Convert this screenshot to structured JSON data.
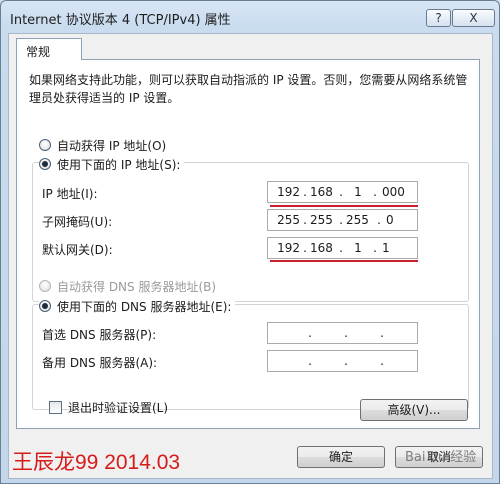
{
  "window": {
    "title": "Internet 协议版本 4 (TCP/IPv4) 属性",
    "help_label": "?",
    "close_label": "X"
  },
  "tab": {
    "general_label": "常规"
  },
  "description": "如果网络支持此功能，则可以获取自动指派的 IP 设置。否则，您需要从网络系统管理员处获得适当的 IP 设置。",
  "ip_section": {
    "auto_label": "自动获得 IP 地址(O)",
    "manual_label": "使用下面的 IP 地址(S):",
    "fields": [
      {
        "label": "IP 地址(I):",
        "octets": [
          "192",
          "168",
          "1",
          "000"
        ],
        "sep": "."
      },
      {
        "label": "子网掩码(U):",
        "octets": [
          "255",
          "255",
          "255",
          "0"
        ],
        "sep": "."
      },
      {
        "label": "默认网关(D):",
        "octets": [
          "192",
          "168",
          "1",
          "1"
        ],
        "sep": "."
      }
    ]
  },
  "dns_section": {
    "auto_label": "自动获得 DNS 服务器地址(B)",
    "manual_label": "使用下面的 DNS 服务器地址(E):",
    "fields": [
      {
        "label": "首选 DNS 服务器(P):",
        "octets": [
          "",
          "",
          "",
          ""
        ],
        "sep": "."
      },
      {
        "label": "备用 DNS 服务器(A):",
        "octets": [
          "",
          "",
          "",
          ""
        ],
        "sep": "."
      }
    ]
  },
  "validate_label": "退出时验证设置(L)",
  "advanced_label": "高级(V)...",
  "ok_label": "确定",
  "cancel_label": "取消",
  "watermark": "王辰龙99 2014.03",
  "baidu_watermark": "Bai du 经验",
  "colors": {
    "annotation_red": "#cc1f2f",
    "watermark_red": "#d61b1b"
  }
}
